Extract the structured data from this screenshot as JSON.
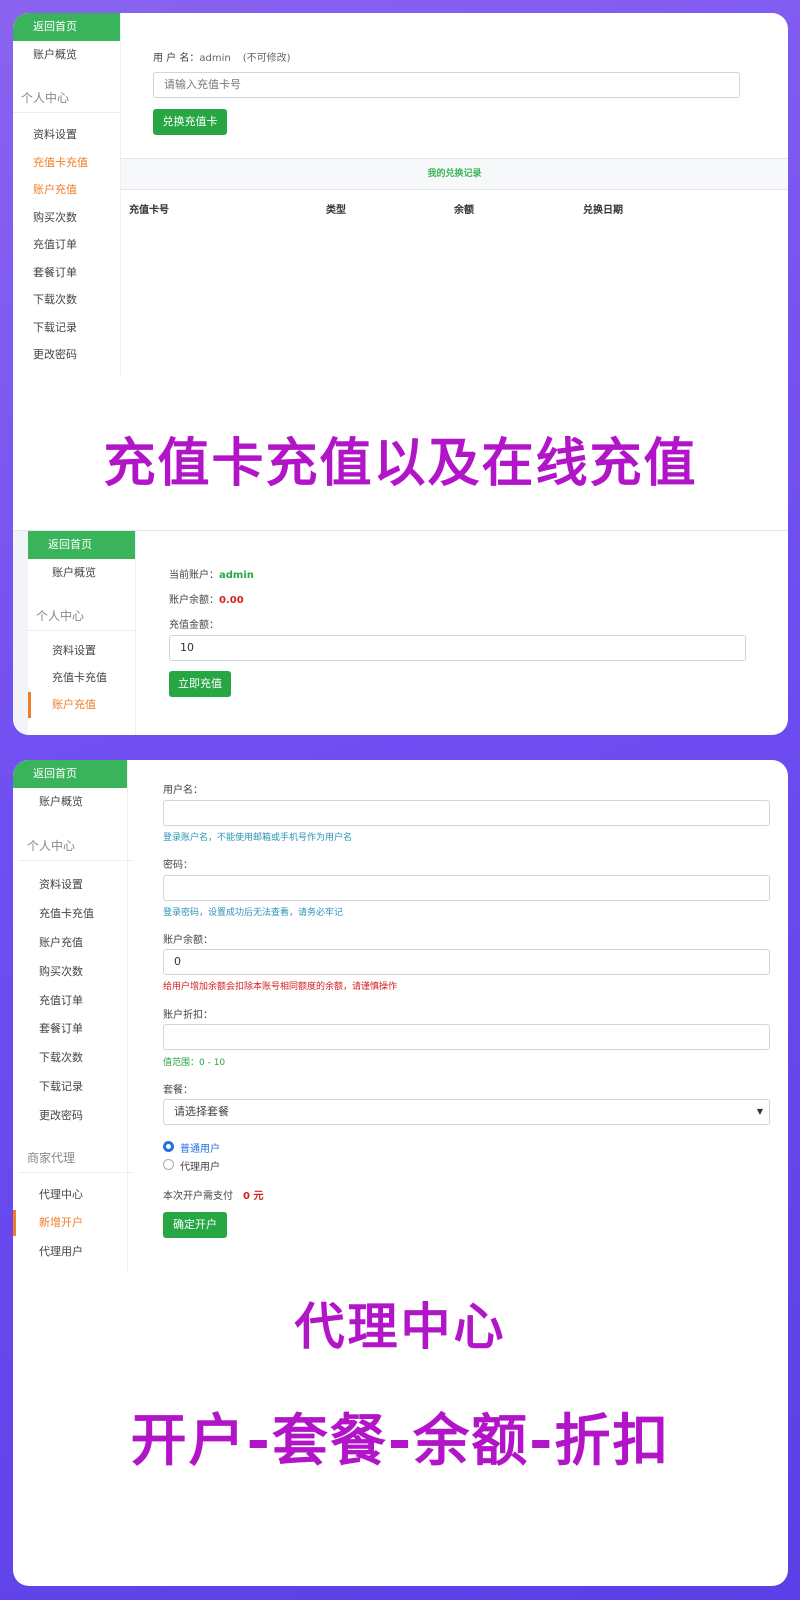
{
  "shot1": {
    "sidebar": {
      "home": "返回首页",
      "overview": "账户概览",
      "section_personal": "个人中心",
      "items": [
        "资料设置",
        "充值卡充值",
        "账户充值",
        "购买次数",
        "充值订单",
        "套餐订单",
        "下载次数",
        "下载记录",
        "更改密码"
      ]
    },
    "username_label": "用 户 名：",
    "username_value": "admin",
    "username_note": "(不可修改)",
    "card_input_placeholder": "请输入充值卡号",
    "redeem_button": "兑换充值卡",
    "records_title": "我的兑换记录",
    "table_headers": [
      "充值卡号",
      "类型",
      "余额",
      "兑换日期"
    ]
  },
  "caption1": "充值卡充值以及在线充值",
  "shot2": {
    "sidebar": {
      "home": "返回首页",
      "overview": "账户概览",
      "section_personal": "个人中心",
      "items": [
        "资料设置",
        "充值卡充值",
        "账户充值"
      ]
    },
    "current_account_label": "当前账户：",
    "current_account_value": "admin",
    "balance_label": "账户余额：",
    "balance_value": "0.00",
    "amount_label": "充值金额：",
    "amount_value": "10",
    "recharge_button": "立即充值"
  },
  "shot3": {
    "sidebar": {
      "home": "返回首页",
      "overview": "账户概览",
      "section_personal": "个人中心",
      "items": [
        "资料设置",
        "充值卡充值",
        "账户充值",
        "购买次数",
        "充值订单",
        "套餐订单",
        "下载次数",
        "下载记录",
        "更改密码"
      ],
      "section_agent": "商家代理",
      "agent_items": [
        "代理中心",
        "新增开户",
        "代理用户"
      ]
    },
    "username_label": "用户名：",
    "username_hint": "登录账户名，不能使用邮箱或手机号作为用户名",
    "password_label": "密码：",
    "password_hint": "登录密码，设置成功后无法查看，请务必牢记",
    "balance_label": "账户余额：",
    "balance_value": "0",
    "balance_hint": "给用户增加余额会扣除本账号相同额度的余额，请谨慎操作",
    "discount_label": "账户折扣：",
    "discount_hint": "值范围：0 - 10",
    "package_label": "套餐：",
    "package_placeholder": "请选择套餐",
    "radio_normal": "普通用户",
    "radio_agent": "代理用户",
    "pay_label": "本次开户需支付",
    "pay_value": "0 元",
    "confirm_button": "确定开户"
  },
  "caption2": "代理中心",
  "caption3": "开户-套餐-余额-折扣",
  "colors": {
    "background": "#6f4ef2",
    "accent_green": "#27a744",
    "accent_orange": "#f07d2a",
    "caption_purple": "#b214c8",
    "price_red": "#d42020"
  }
}
